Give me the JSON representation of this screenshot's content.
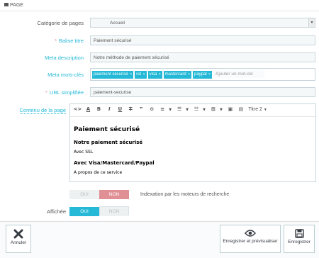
{
  "panel": {
    "title": "PAGE"
  },
  "fields": {
    "category": {
      "label": "Catégorie de pages",
      "value": "Accueil"
    },
    "title": {
      "label": "Balise titre",
      "value": "Paiement sécurisé"
    },
    "meta_description": {
      "label": "Meta description",
      "value": "Notre méthode de paiement sécurisé"
    },
    "meta_keywords": {
      "label": "Meta mots-clés",
      "tags": [
        "paiement sécurisé",
        "ssl",
        "visa",
        "mastercard",
        "paypal"
      ],
      "placeholder": "Ajouter un mot-clé"
    },
    "url": {
      "label": "URL simplifiée",
      "value": "paiement-securise"
    },
    "content": {
      "label": "Contenu de la page",
      "format_select": "Titre 2",
      "heading1": "Paiement sécurisé",
      "heading3a": "Notre paiement sécurisé",
      "p1": "Avec SSL",
      "heading3b": "Avec Visa/Mastercard/Paypal",
      "p2": "A propos de ce service"
    },
    "indexation": {
      "yes": "OUI",
      "no": "NON",
      "help": "Indexation par les moteurs de recherche",
      "selected": "NON"
    },
    "display": {
      "label": "Affichée",
      "yes": "OUI",
      "no": "NON",
      "selected": "OUI"
    }
  },
  "footer": {
    "cancel": "Annuler",
    "save_preview": "Enregistrer et prévisualiser",
    "save": "Enregistrer"
  },
  "colors": {
    "accent": "#25b9d7",
    "danger": "#e08f95",
    "required": "#e08f95"
  }
}
